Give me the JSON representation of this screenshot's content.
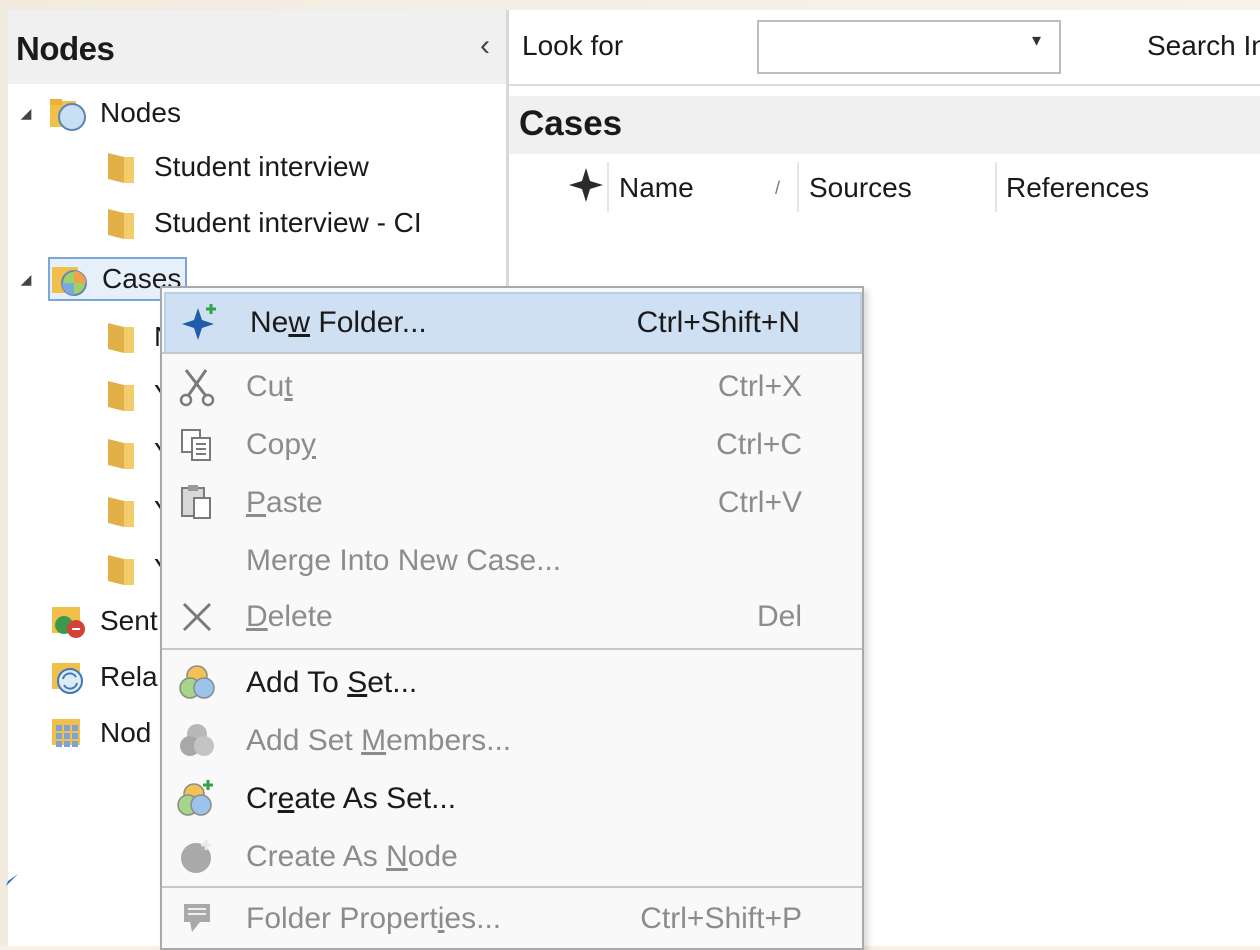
{
  "left_panel": {
    "title": "Nodes",
    "collapse_glyph": "‹",
    "tree": [
      {
        "label": "Nodes",
        "icon": "nodes-folder-icon",
        "expanded": true
      },
      {
        "label": "Student interview",
        "icon": "folder-icon"
      },
      {
        "label": "Student interview - CI",
        "icon": "folder-icon"
      },
      {
        "label": "Cases",
        "icon": "cases-folder-icon",
        "expanded": true,
        "selected": true
      },
      {
        "label": "N",
        "icon": "folder-icon"
      },
      {
        "label": "Y",
        "icon": "folder-icon"
      },
      {
        "label": "Y",
        "icon": "folder-icon"
      },
      {
        "label": "Y",
        "icon": "folder-icon"
      },
      {
        "label": "Y",
        "icon": "folder-icon"
      },
      {
        "label": "Sent",
        "icon": "sentiment-folder-icon"
      },
      {
        "label": "Rela",
        "icon": "relationships-folder-icon"
      },
      {
        "label": "Nod",
        "icon": "node-matrices-folder-icon"
      }
    ]
  },
  "right_panel": {
    "look_for_label": "Look for",
    "look_for_value": "",
    "search_label": "Search In",
    "section_title": "Cases",
    "columns": [
      "Name",
      "Sources",
      "References"
    ],
    "sort_glyph": "/"
  },
  "context_menu": {
    "items": [
      {
        "pre": "Ne",
        "mn": "w",
        "post": " Folder...",
        "shortcut": "Ctrl+Shift+N",
        "enabled": true,
        "highlight": true,
        "icon": "new-folder-icon"
      },
      {
        "pre": "Cu",
        "mn": "t",
        "post": "",
        "shortcut": "Ctrl+X",
        "enabled": false,
        "icon": "scissors-icon"
      },
      {
        "pre": "Cop",
        "mn": "y",
        "post": "",
        "shortcut": "Ctrl+C",
        "enabled": false,
        "icon": "copy-icon"
      },
      {
        "pre": "",
        "mn": "P",
        "post": "aste",
        "shortcut": "Ctrl+V",
        "enabled": false,
        "icon": "paste-icon"
      },
      {
        "pre": "Mer",
        "mn": "g",
        "post": "e Into New Case...",
        "shortcut": "",
        "enabled": false,
        "icon": ""
      },
      {
        "pre": "",
        "mn": "D",
        "post": "elete",
        "shortcut": "Del",
        "enabled": false,
        "icon": "delete-icon"
      },
      {
        "pre": "Add To ",
        "mn": "S",
        "post": "et...",
        "shortcut": "",
        "enabled": true,
        "icon": "add-to-set-icon"
      },
      {
        "pre": "Add Set ",
        "mn": "M",
        "post": "embers...",
        "shortcut": "",
        "enabled": false,
        "icon": "add-set-members-icon"
      },
      {
        "pre": "Cr",
        "mn": "e",
        "post": "ate As Set...",
        "shortcut": "",
        "enabled": true,
        "icon": "create-set-icon"
      },
      {
        "pre": "Create As ",
        "mn": "N",
        "post": "ode",
        "shortcut": "",
        "enabled": false,
        "icon": "create-node-icon"
      },
      {
        "pre": "Folder Propert",
        "mn": "i",
        "post": "es...",
        "shortcut": "Ctrl+Shift+P",
        "enabled": false,
        "icon": "folder-properties-icon"
      }
    ]
  }
}
